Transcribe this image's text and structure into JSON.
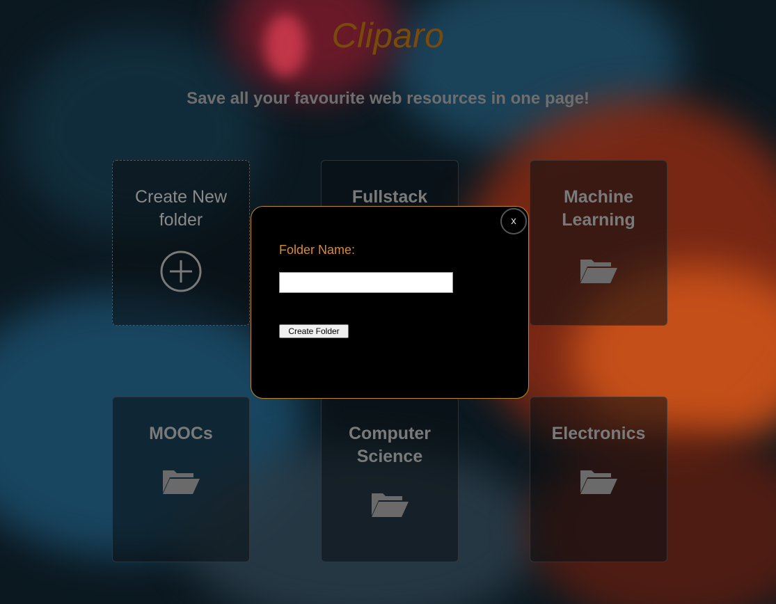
{
  "header": {
    "title": "Cliparo",
    "subtitle": "Save all your favourite web resources in one page!"
  },
  "cards": {
    "new_folder": {
      "label": "Create New folder",
      "icon": "plus-circle-icon"
    },
    "folders": [
      {
        "label": "Fullstack",
        "icon": "folder-open-icon"
      },
      {
        "label": "Machine Learning",
        "icon": "folder-open-icon"
      },
      {
        "label": "MOOCs",
        "icon": "folder-open-icon"
      },
      {
        "label": "Computer Science",
        "icon": "folder-open-icon"
      },
      {
        "label": "Electronics",
        "icon": "folder-open-icon"
      }
    ]
  },
  "modal": {
    "close_label": "x",
    "field_label": "Folder Name:",
    "input_value": "",
    "submit_label": "Create Folder"
  },
  "colors": {
    "title": "#7a4a0a",
    "modal_accent": "#e08a2a",
    "modal_border": "#c08a2a",
    "card_text": "#7a7a7a"
  }
}
